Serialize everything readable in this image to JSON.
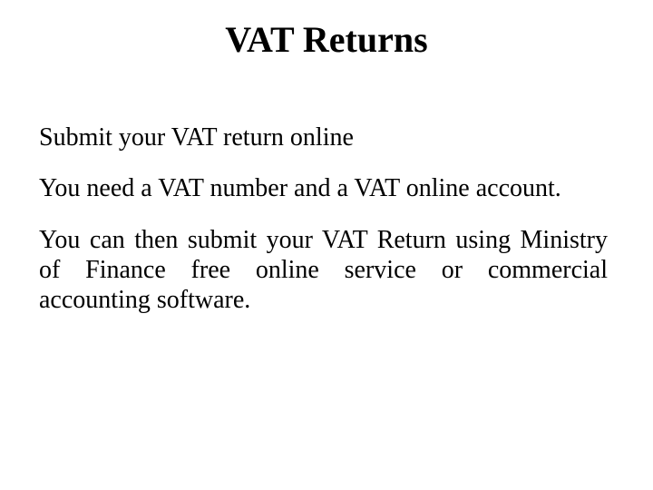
{
  "slide": {
    "title": "VAT Returns",
    "paragraphs": [
      "Submit your VAT return online",
      "You need a VAT number and a VAT online account.",
      "You can then submit your VAT Return using Ministry of Finance free online service or commercial accounting software."
    ]
  }
}
